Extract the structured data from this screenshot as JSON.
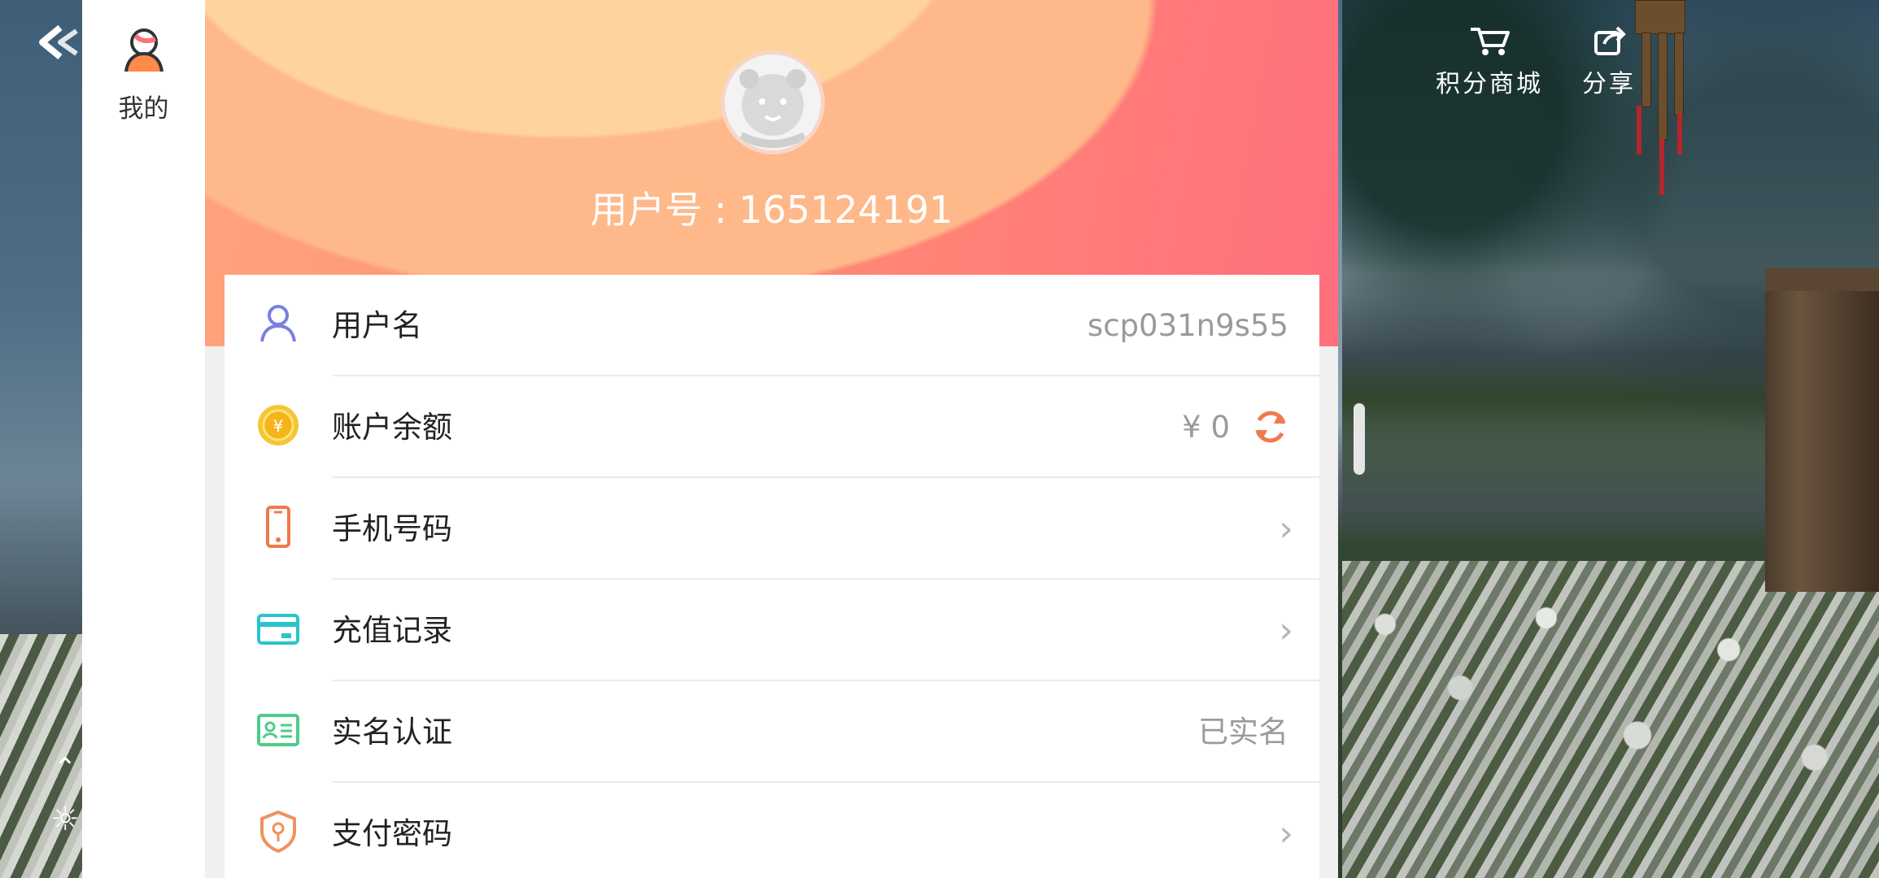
{
  "nav": {
    "mine_label": "我的"
  },
  "header": {
    "user_id_text": "用户号 : 165124191"
  },
  "rows": [
    {
      "label": "用户名",
      "value": "scp031n9s55",
      "icon": "user-icon"
    },
    {
      "label": "账户余额",
      "value": "¥ 0",
      "icon": "coin-icon"
    },
    {
      "label": "手机号码",
      "value": "",
      "icon": "phone-icon"
    },
    {
      "label": "充值记录",
      "value": "",
      "icon": "card-icon"
    },
    {
      "label": "实名认证",
      "value": "已实名",
      "icon": "id-card-icon"
    },
    {
      "label": "支付密码",
      "value": "",
      "icon": "lock-shield-icon"
    }
  ],
  "top_actions": {
    "points_mall": "积分商城",
    "share": "分享"
  },
  "colors": {
    "header_start": "#ffa47c",
    "header_end": "#ff6f7c",
    "refresh": "#f07a4e"
  }
}
